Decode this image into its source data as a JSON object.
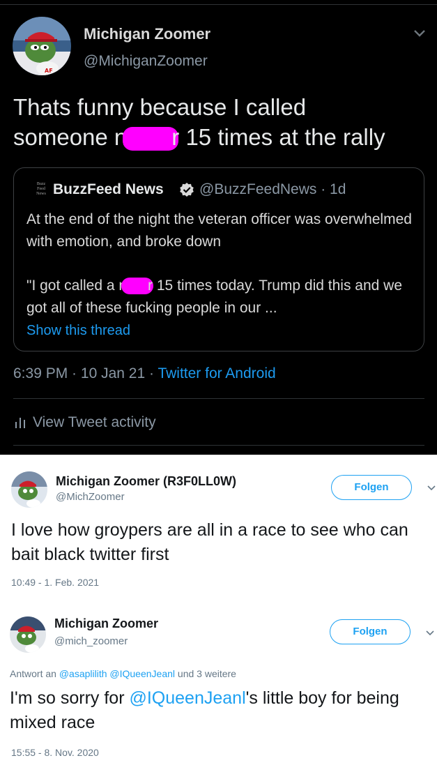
{
  "dark_tweet": {
    "author_name": "Michigan Zoomer",
    "author_handle": "@MichiganZoomer",
    "text_line1": "Thats funny because I called",
    "text_line2_a": "someone n",
    "text_line2_b": "r 15 times at the rally",
    "quote": {
      "logo_text": "BuzzFeed News",
      "name": "BuzzFeed News",
      "handle_time": "@BuzzFeedNews · 1d",
      "para1": "At the end of the night the veteran officer was overwhelmed with emotion, and broke down",
      "para2_a": "\"I got called a n",
      "para2_b": "r 15 times today. Trump did this and we got all of these fucking people in our ...",
      "show_thread": "Show this thread"
    },
    "time": "6:39 PM",
    "dot": " · ",
    "date": "10 Jan 21",
    "source": "Twitter for Android",
    "activity": "View Tweet activity"
  },
  "tweet1": {
    "author_name": "Michigan Zoomer (R3F0LL0W)",
    "author_handle": "@MichZoomer",
    "follow_label": "Folgen",
    "text": "I love how groypers are all in a race to see who can bait black twitter first",
    "timestamp": "10:49 - 1. Feb. 2021"
  },
  "tweet2": {
    "author_name": "Michigan Zoomer",
    "author_handle": "@mich_zoomer",
    "follow_label": "Folgen",
    "reply_prefix": "Antwort an ",
    "reply_mention1": "@asaplilith",
    "reply_mention2": "@IQueenJeanl",
    "reply_suffix": " und 3 weitere",
    "text_mention": "@IQueenJeanl",
    "text_rest": "'s little boy for being mixed race",
    "text_prefix": "I'm so sorry for ",
    "timestamp": "15:55 - 8. Nov. 2020"
  },
  "colors": {
    "accent": "#1da1f2",
    "dark_link": "#1d9bf0",
    "censor": "#ff00ff"
  }
}
